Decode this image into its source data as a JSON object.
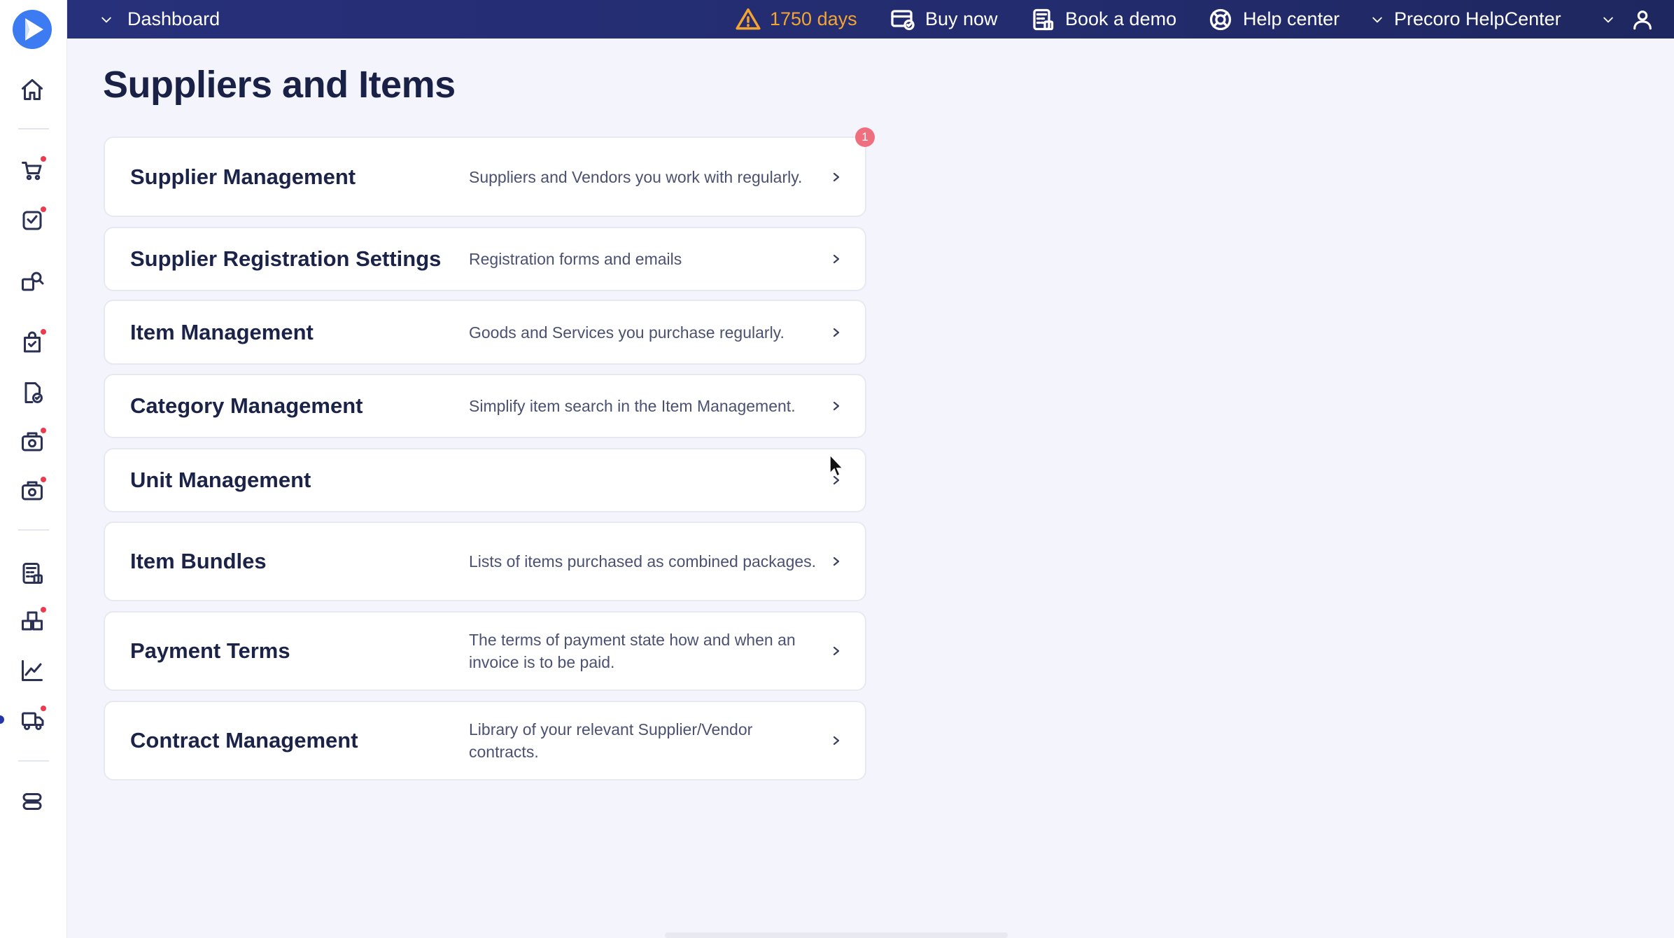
{
  "topbar": {
    "dashboard_label": "Dashboard",
    "trial_days": "1750 days",
    "buy_now": "Buy now",
    "book_demo": "Book a demo",
    "help_center": "Help center",
    "company": "Precoro HelpCenter"
  },
  "page": {
    "title": "Suppliers and Items",
    "badge_count": "1"
  },
  "cards": [
    {
      "title": "Supplier Management",
      "desc": "Suppliers and Vendors you work with regularly."
    },
    {
      "title": "Supplier Registration Settings",
      "desc": "Registration forms and emails"
    },
    {
      "title": "Item Management",
      "desc": "Goods and Services you purchase regularly."
    },
    {
      "title": "Category Management",
      "desc": "Simplify item search in the Item Management."
    },
    {
      "title": "Unit Management",
      "desc": ""
    },
    {
      "title": "Item Bundles",
      "desc": "Lists of items purchased as combined packages."
    },
    {
      "title": "Payment Terms",
      "desc": "The terms of payment state how and when an invoice is to be paid."
    },
    {
      "title": "Contract Management",
      "desc": "Library of your relevant Supplier/Vendor contracts."
    }
  ],
  "sidebar_icons": [
    {
      "name": "home-icon",
      "notification": false
    },
    {
      "name": "purchase-requests-icon",
      "notification": true
    },
    {
      "name": "approvals-icon",
      "notification": true
    },
    {
      "name": "rfq-icon",
      "notification": false
    },
    {
      "name": "purchase-orders-icon",
      "notification": true
    },
    {
      "name": "invoices-icon",
      "notification": false
    },
    {
      "name": "receipts-icon",
      "notification": true
    },
    {
      "name": "payments-icon",
      "notification": true
    },
    {
      "name": "budgets-icon",
      "notification": false
    },
    {
      "name": "warehouse-icon",
      "notification": true
    },
    {
      "name": "analytics-icon",
      "notification": false
    },
    {
      "name": "suppliers-items-icon",
      "notification": true
    },
    {
      "name": "settings-icon",
      "notification": false
    }
  ],
  "colors": {
    "topbar": "#27307a",
    "warning": "#f4a531",
    "notification": "#ec3a4f",
    "accent": "#3d7bf2"
  }
}
